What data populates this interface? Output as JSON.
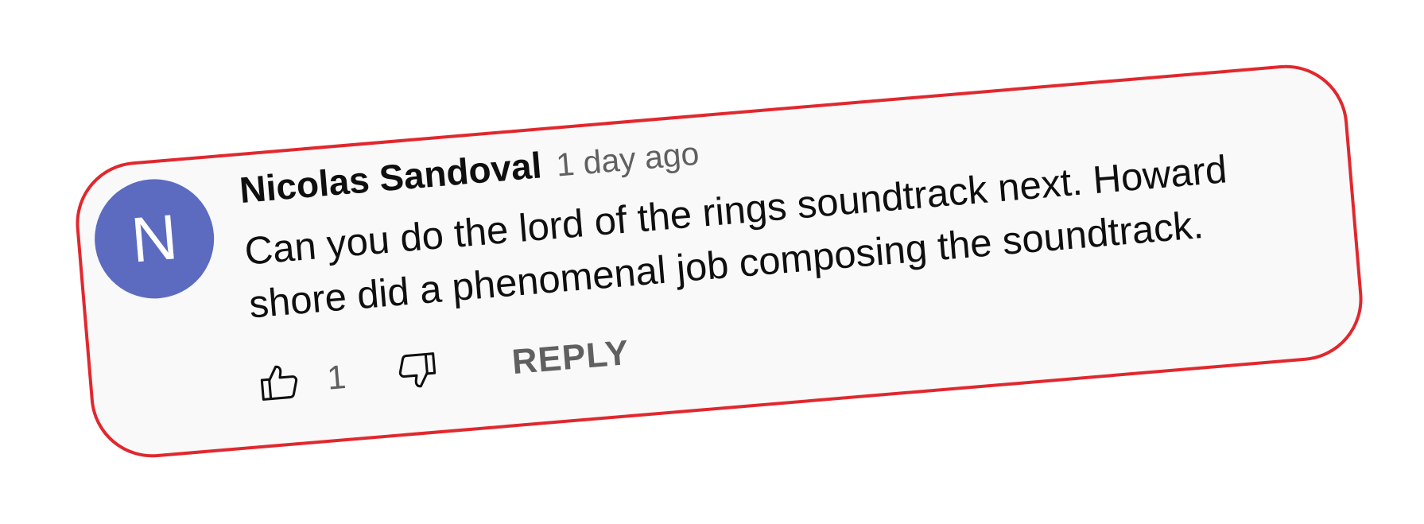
{
  "comment": {
    "avatar_initial": "N",
    "author": "Nicolas Sandoval",
    "timestamp": "1 day ago",
    "text": "Can you do the lord of the rings soundtrack next. Howard shore did a phenomenal job composing the soundtrack.",
    "like_count": "1",
    "reply_label": "REPLY",
    "avatar_color": "#5c6bc0",
    "highlight_border_color": "#e0282e"
  },
  "icons": {
    "like": "thumbs-up-icon",
    "dislike": "thumbs-down-icon"
  }
}
